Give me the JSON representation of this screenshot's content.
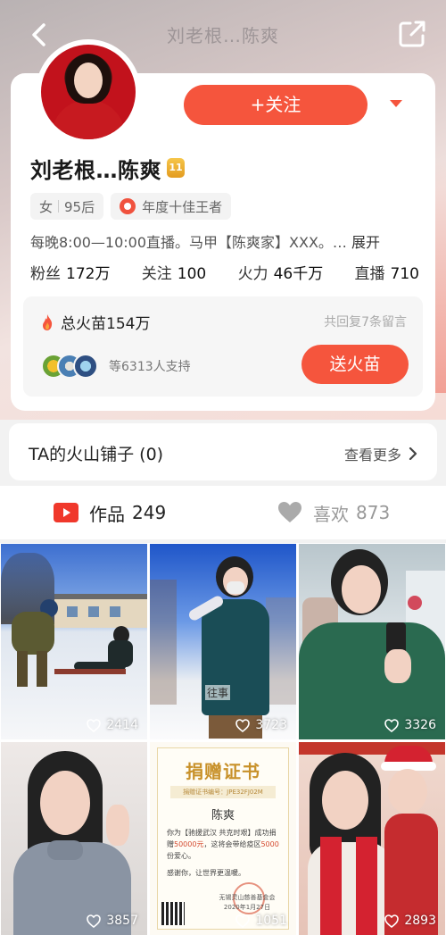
{
  "nav": {
    "title": "刘老根…陈爽"
  },
  "profile": {
    "follow_label": "+关注",
    "name": "刘老根…陈爽",
    "level": "11",
    "tags": {
      "gender": "女",
      "age": "95后",
      "honor": "年度十佳王者"
    },
    "bio": "每晚8:00—10:00直播。马甲【陈爽家】XXX。…",
    "bio_expand": "展开",
    "stats": {
      "fans_label": "粉丝",
      "fans_value": "172万",
      "following_label": "关注",
      "following_value": "100",
      "fire_label": "火力",
      "fire_value": "46千万",
      "live_label": "直播",
      "live_value": "710"
    },
    "fire": {
      "total": "总火苗154万",
      "replies": "共回复7条留言",
      "supporters": "等6313人支持",
      "send_label": "送火苗"
    }
  },
  "shop": {
    "title": "TA的火山铺子 (0)",
    "more": "查看更多"
  },
  "tabs": {
    "works_label": "作品",
    "works_count": "249",
    "likes_label": "喜欢",
    "likes_count": "873"
  },
  "videos": [
    {
      "likes": "2414"
    },
    {
      "likes": "3723"
    },
    {
      "likes": "3326"
    },
    {
      "likes": "3857"
    },
    {
      "likes": "1051"
    },
    {
      "likes": "2893"
    }
  ],
  "certificate": {
    "title": "捐赠证书",
    "number": "捐赠证书编号：JPE32FJ02M",
    "name": "陈爽",
    "body_1": "你为【驰援武汉 共克时艰】成功捐赠",
    "amount": "50000元",
    "body_2": "，这将会带给疫区",
    "count": "5000",
    "body_3": "份爱心。",
    "thanks": "感谢你，让世界更温暖。",
    "org": "无锡灵山慈善基金会",
    "date": "2020年1月27日"
  },
  "caption_text": "往事",
  "colors": {
    "accent": "#f5553d",
    "gold": "#c8912a"
  }
}
